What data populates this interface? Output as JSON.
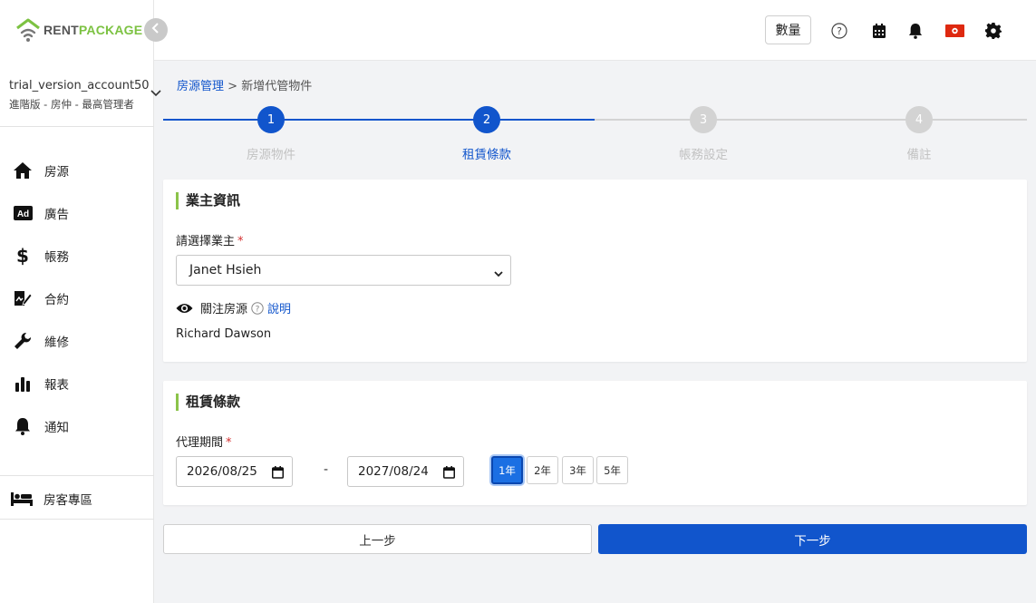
{
  "brand": {
    "name_part1": "RENT",
    "name_part2": "PACKAGE",
    "accent": "#7cc242"
  },
  "account": {
    "name": "trial_version_account50",
    "role": "進階版 - 房仲 - 最高管理者"
  },
  "sidebar": {
    "items": [
      {
        "label": "房源",
        "icon": "home-icon"
      },
      {
        "label": "廣告",
        "icon": "ad-icon"
      },
      {
        "label": "帳務",
        "icon": "dollar-icon"
      },
      {
        "label": "合約",
        "icon": "contract-icon"
      },
      {
        "label": "維修",
        "icon": "wrench-icon"
      },
      {
        "label": "報表",
        "icon": "bar-chart-icon"
      },
      {
        "label": "通知",
        "icon": "bell-icon"
      }
    ],
    "bottom_item": {
      "label": "房客專區",
      "icon": "bed-icon"
    }
  },
  "header": {
    "qty_label": "數量",
    "icons": [
      "help-icon",
      "calendar-icon",
      "bell-icon",
      "flag-icon",
      "gear-icon"
    ]
  },
  "breadcrumb": {
    "parent": "房源管理",
    "separator": ">",
    "current": "新增代管物件"
  },
  "stepper": {
    "current": 2,
    "steps": [
      {
        "num": "1",
        "label": "房源物件"
      },
      {
        "num": "2",
        "label": "租賃條款"
      },
      {
        "num": "3",
        "label": "帳務設定"
      },
      {
        "num": "4",
        "label": "備註"
      }
    ],
    "colors": {
      "active": "#1155cc",
      "inactive": "#d0d0d0",
      "done_label": "#c7c7c7",
      "active_label": "#1155cc"
    }
  },
  "owner_card": {
    "title": "業主資訊",
    "select_label": "請選擇業主",
    "required_mark": "*",
    "selected_owner": "Janet Hsieh",
    "watch_label": "關注房源",
    "help_link": "說明",
    "watcher": "Richard Dawson"
  },
  "lease_card": {
    "title": "租賃條款",
    "period_label": "代理期間",
    "required_mark": "*",
    "start_date": "2026/08/25",
    "date_separator": "-",
    "end_date": "2027/08/24",
    "year_options": [
      "1年",
      "2年",
      "3年",
      "5年"
    ],
    "selected_year_index": 0
  },
  "actions": {
    "prev_label": "上一步",
    "next_label": "下一步"
  }
}
